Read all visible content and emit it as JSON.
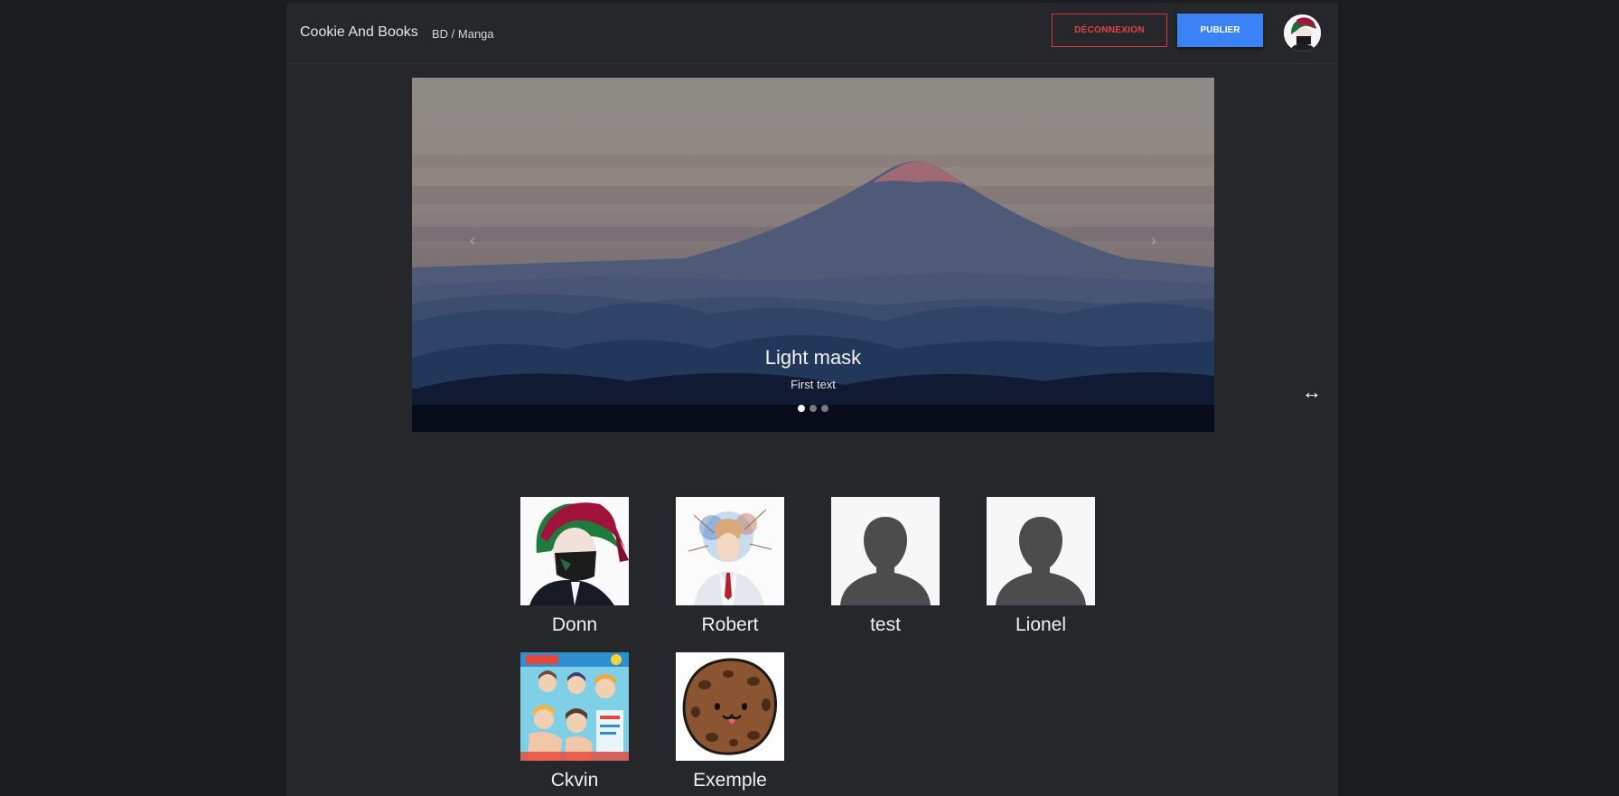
{
  "navbar": {
    "brand": "Cookie And Books",
    "breadcrumb": "BD / Manga",
    "logout_label": "DÉCONNEXION",
    "publish_label": "PUBLIER"
  },
  "carousel": {
    "caption_title": "Light mask",
    "caption_text": "First text",
    "prev_glyph": "‹",
    "next_glyph": "›",
    "slide_count": 3,
    "active_slide": 1
  },
  "users": [
    {
      "name": "Donn",
      "avatar": "anime-boy-green-hair"
    },
    {
      "name": "Robert",
      "avatar": "sketch-man-suit"
    },
    {
      "name": "test",
      "avatar": "default-silhouette"
    },
    {
      "name": "Lionel",
      "avatar": "default-silhouette"
    },
    {
      "name": "Ckvin",
      "avatar": "manga-cover"
    },
    {
      "name": "Exemple",
      "avatar": "cookie-smiley"
    }
  ],
  "colors": {
    "logout": "#e4434a",
    "publish": "#3b82f6",
    "background": "#25272a"
  },
  "cursor_glyph": "↔"
}
